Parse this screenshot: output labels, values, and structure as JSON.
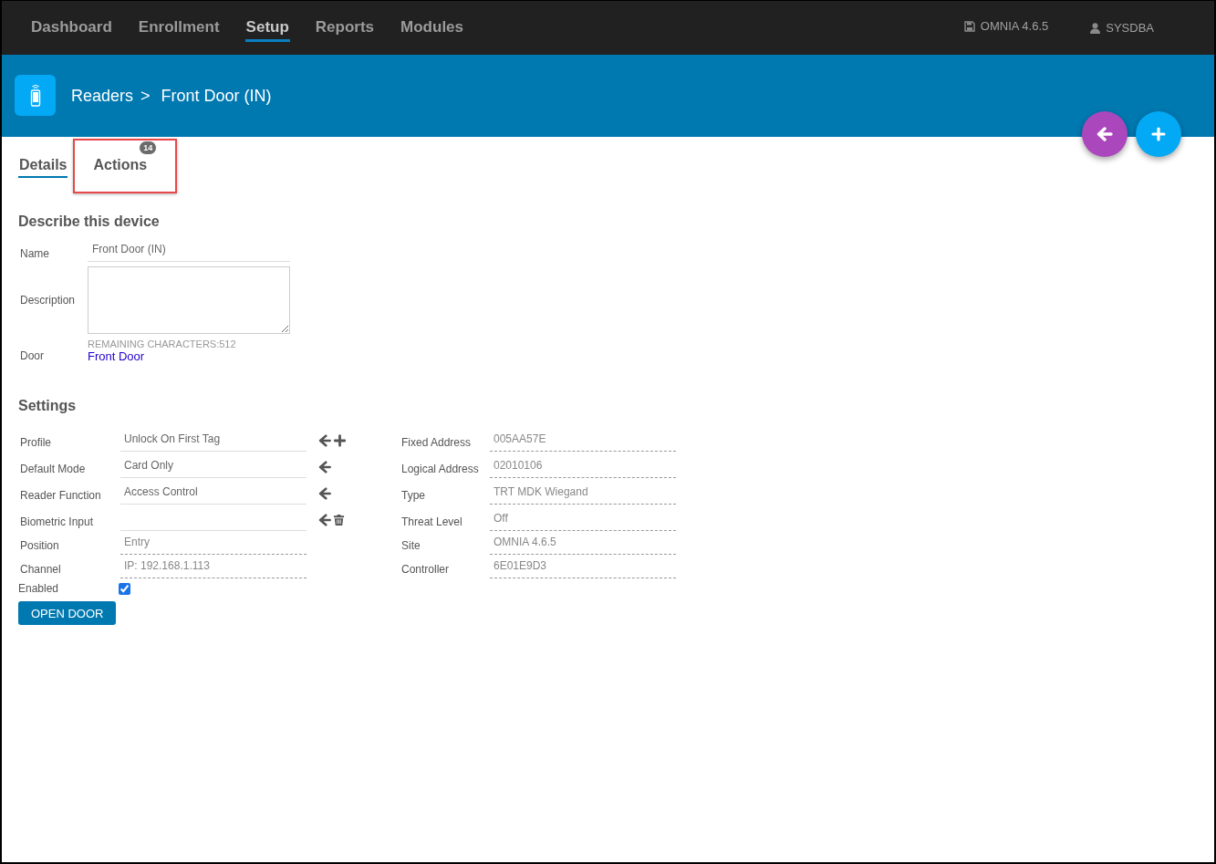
{
  "nav": {
    "items": [
      {
        "label": "Dashboard",
        "selected": false
      },
      {
        "label": "Enrollment",
        "selected": false
      },
      {
        "label": "Setup",
        "selected": true
      },
      {
        "label": "Reports",
        "selected": false
      },
      {
        "label": "Modules",
        "selected": false
      }
    ],
    "version": "OMNIA 4.6.5",
    "user": "SYSDBA"
  },
  "header": {
    "breadcrumb": [
      "Readers",
      ">",
      "Front Door (IN)"
    ]
  },
  "tabs": [
    {
      "label": "Details",
      "selected": true,
      "highlighted": false
    },
    {
      "label": "Actions",
      "selected": false,
      "highlighted": true,
      "badge": "14"
    }
  ],
  "describe": {
    "title": "Describe this device",
    "name": {
      "label": "Name",
      "value": "Front Door (IN)"
    },
    "description": {
      "label": "Description",
      "remaining": "REMAINING CHARACTERS:512"
    },
    "door": {
      "label": "Door",
      "link": "Front Door"
    }
  },
  "settings": {
    "title": "Settings",
    "left": [
      {
        "label": "Profile",
        "value": "Unlock On First Tag",
        "kind": "select",
        "actions": [
          {
            "kind": "back"
          },
          {
            "kind": "add"
          }
        ]
      },
      {
        "label": "Default Mode",
        "value": "Card Only",
        "kind": "select",
        "actions": [
          {
            "kind": "back"
          }
        ]
      },
      {
        "label": "Reader Function",
        "value": "Access Control",
        "kind": "select",
        "actions": [
          {
            "kind": "back"
          }
        ]
      },
      {
        "label": "Biometric Input",
        "kind": "select",
        "actions": [
          {
            "kind": "back"
          },
          {
            "kind": "delete"
          }
        ]
      },
      {
        "label": "Position",
        "value": "Entry",
        "kind": "readonly"
      },
      {
        "label": "Channel",
        "value": "IP: 192.168.1.113",
        "kind": "readonly"
      }
    ],
    "right": [
      {
        "label": "Fixed Address",
        "value": "005AA57E",
        "kind": "readonly"
      },
      {
        "label": "Logical Address",
        "value": "02010106",
        "kind": "readonly"
      },
      {
        "label": "Type",
        "value": "TRT MDK Wiegand",
        "kind": "readonly"
      },
      {
        "label": "Threat Level",
        "value": "Off",
        "kind": "readonly"
      },
      {
        "label": "Site",
        "value": "OMNIA 4.6.5",
        "kind": "readonly"
      },
      {
        "label": "Controller",
        "value": "6E01E9D3",
        "kind": "readonly"
      }
    ],
    "enabled": {
      "label": "Enabled",
      "checked": true
    },
    "button": "OPEN DOOR"
  }
}
